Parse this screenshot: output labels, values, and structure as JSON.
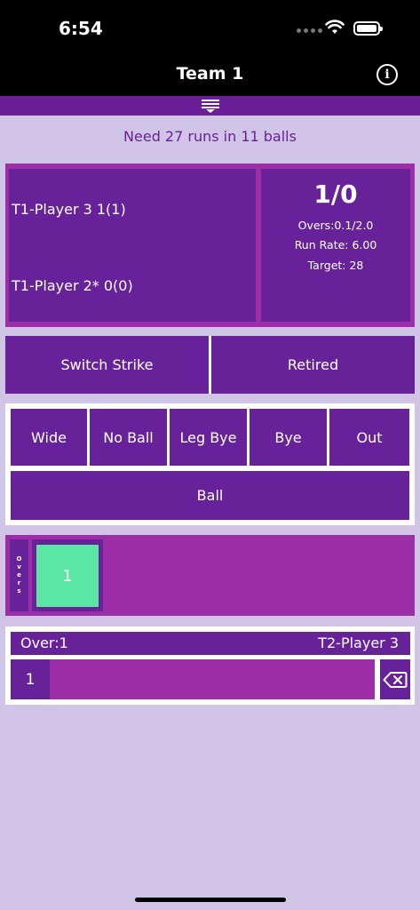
{
  "status": {
    "time": "6:54"
  },
  "nav": {
    "title": "Team 1"
  },
  "message": "Need 27 runs in 11 balls",
  "players": {
    "non_striker": "T1-Player 3 1(1)",
    "striker": "T1-Player 2* 0(0)"
  },
  "stats": {
    "score": "1/0",
    "overs": "Overs:0.1/2.0",
    "run_rate": "Run Rate: 6.00",
    "target": "Target: 28"
  },
  "actions": {
    "switch_strike": "Switch Strike",
    "retired": "Retired",
    "wide": "Wide",
    "no_ball": "No Ball",
    "leg_bye": "Leg Bye",
    "bye": "Bye",
    "out": "Out",
    "ball": "Ball"
  },
  "overs_panel": {
    "label_letters": [
      "O",
      "v",
      "e",
      "r",
      "s"
    ],
    "cards": [
      "1"
    ]
  },
  "current_over": {
    "label": "Over:1",
    "bowler": "T2-Player 3",
    "balls": [
      "1"
    ]
  },
  "colors": {
    "primary": "#67229a",
    "accent": "#9c2fa8",
    "background": "#d1c5e7",
    "over_card": "#5be6a5"
  }
}
